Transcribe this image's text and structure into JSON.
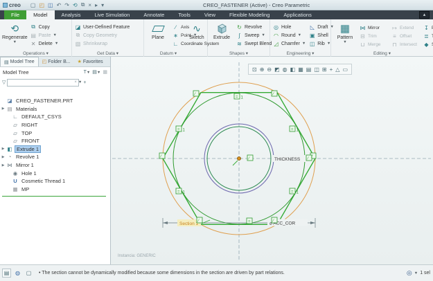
{
  "colors": {
    "file_tab_green": "#3f9e35",
    "selection_blue": "#aed0f0",
    "sketch_orange": "#dfa050",
    "sketch_green": "#35ab35",
    "sketch_inner_green": "#2e8a52",
    "sketch_purple": "#6b66ad",
    "tree_separator_green": "#3aa53a"
  },
  "titlebar": {
    "logo": "creo",
    "title": "CREO_FASTENER (Active) - Creo Parametric",
    "qat": [
      "▢",
      "◰",
      "◫",
      "↶",
      "↷",
      "⟲",
      "⧉",
      "×",
      "▸",
      "▾"
    ]
  },
  "tabs": {
    "file": "File",
    "model": "Model",
    "analysis": "Analysis",
    "live_simulation": "Live Simulation",
    "annotate": "Annotate",
    "tools": "Tools",
    "view": "View",
    "flexible_modeling": "Flexible Modeling",
    "applications": "Applications",
    "collapse": "▴"
  },
  "ribbon": {
    "operations": {
      "label": "Operations ▾",
      "regenerate": "Regenerate",
      "copy": "Copy",
      "paste": "Paste",
      "delete": "Delete"
    },
    "get_data": {
      "label": "Get Data ▾",
      "user_defined_feature": "User-Defined Feature",
      "copy_geometry": "Copy Geometry",
      "shrinkwrap": "Shrinkwrap"
    },
    "datum": {
      "label": "Datum ▾",
      "plane": "Plane",
      "axis": "Axis",
      "point": "Point",
      "coordinate_system": "Coordinate System",
      "sketch": "Sketch"
    },
    "shapes": {
      "label": "Shapes ▾",
      "extrude": "Extrude",
      "revolve": "Revolve",
      "sweep": "Sweep",
      "swept_blend": "Swept Blend"
    },
    "engineering": {
      "label": "Engineering ▾",
      "hole": "Hole",
      "round": "Round",
      "chamfer": "Chamfer",
      "draft": "Draft",
      "shell": "Shell",
      "rib": "Rib"
    },
    "editing": {
      "label": "Editing ▾",
      "pattern": "Pattern",
      "mirror": "Mirror",
      "trim": "Trim",
      "merge": "Merge",
      "extend": "Extend",
      "offset": "Offset",
      "intersect": "Intersect",
      "project": "Project",
      "thicken": "Thicken",
      "solidify": "Solidify"
    }
  },
  "panel": {
    "tabs": {
      "model_tree": "Model Tree",
      "folder_browser": "Folder B...",
      "favorites": "Favorites"
    },
    "header": "Model Tree",
    "filter_value": "",
    "items": [
      {
        "label": "CREO_FASTENER.PRT"
      },
      {
        "label": "Materials"
      },
      {
        "label": "DEFAULT_CSYS"
      },
      {
        "label": "RIGHT"
      },
      {
        "label": "TOP"
      },
      {
        "label": "FRONT"
      },
      {
        "label": "Extrude 1"
      },
      {
        "label": "Revolve 1"
      },
      {
        "label": "Mirror 1"
      },
      {
        "label": "Hole 1"
      },
      {
        "label": "Cosmetic Thread 1"
      },
      {
        "label": "MP"
      }
    ]
  },
  "canvas": {
    "toolbar": [
      "⊡",
      "⊕",
      "⊖",
      "◩",
      "◍",
      "◧",
      "▦",
      "▤",
      "◫",
      "⊞",
      "+",
      "△",
      "▭"
    ],
    "instance_label": "Instancia: GENERIC",
    "sketch": {
      "thickness_label": "THICKNESS",
      "dimension_label": "⌀ ACC_COR",
      "section_label": "Section 1",
      "equal_glyph": "=",
      "tangent_suffix": "1",
      "constraint_glyph": "∕"
    }
  },
  "statusbar": {
    "bullet": "•",
    "message": "The section cannot be dynamically modified because some dimensions in the section are driven by part relations.",
    "selection_count": "1 sel"
  }
}
